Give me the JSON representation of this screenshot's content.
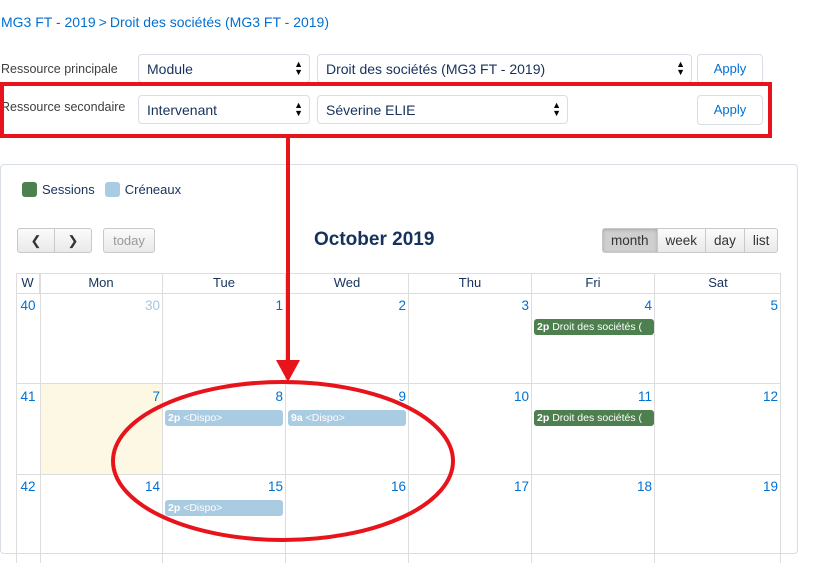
{
  "breadcrumb": {
    "item1": "MG3 FT - 2019",
    "sep": ">",
    "item2": "Droit des sociétés (MG3 FT - 2019)"
  },
  "filters": {
    "primary": {
      "label": "Ressource principale",
      "type_value": "Module",
      "resource_value": "Droit des sociétés (MG3 FT - 2019)",
      "apply": "Apply"
    },
    "secondary": {
      "label": "Ressource secondaire",
      "type_value": "Intervenant",
      "resource_value": "Séverine ELIE",
      "apply": "Apply"
    }
  },
  "legend": {
    "sessions": {
      "label": "Sessions",
      "color": "#4e7f4f"
    },
    "creneaux": {
      "label": "Créneaux",
      "color": "#a9cce3"
    }
  },
  "calendar": {
    "title": "October 2019",
    "prev_icon": "chevron-left-icon",
    "next_icon": "chevron-right-icon",
    "today_label": "today",
    "views": [
      "month",
      "week",
      "day",
      "list"
    ],
    "active_view": "month",
    "header": {
      "week": "W",
      "days": [
        "Mon",
        "Tue",
        "Wed",
        "Thu",
        "Fri",
        "Sat"
      ]
    },
    "weeks": [
      {
        "num": "40",
        "days": [
          "30",
          "1",
          "2",
          "3",
          "4",
          "5"
        ]
      },
      {
        "num": "41",
        "days": [
          "7",
          "8",
          "9",
          "10",
          "11",
          "12"
        ]
      },
      {
        "num": "42",
        "days": [
          "14",
          "15",
          "16",
          "17",
          "18",
          "19"
        ]
      }
    ],
    "events": {
      "e1": {
        "time": "2p",
        "title": "Droit des sociétés ("
      },
      "e2": {
        "time": "2p",
        "title": "<Dispo>"
      },
      "e3": {
        "time": "9a",
        "title": "<Dispo>"
      },
      "e4": {
        "time": "2p",
        "title": "Droit des sociétés ("
      },
      "e5": {
        "time": "2p",
        "title": "<Dispo>"
      }
    }
  },
  "annotation_color": "#e8141b"
}
